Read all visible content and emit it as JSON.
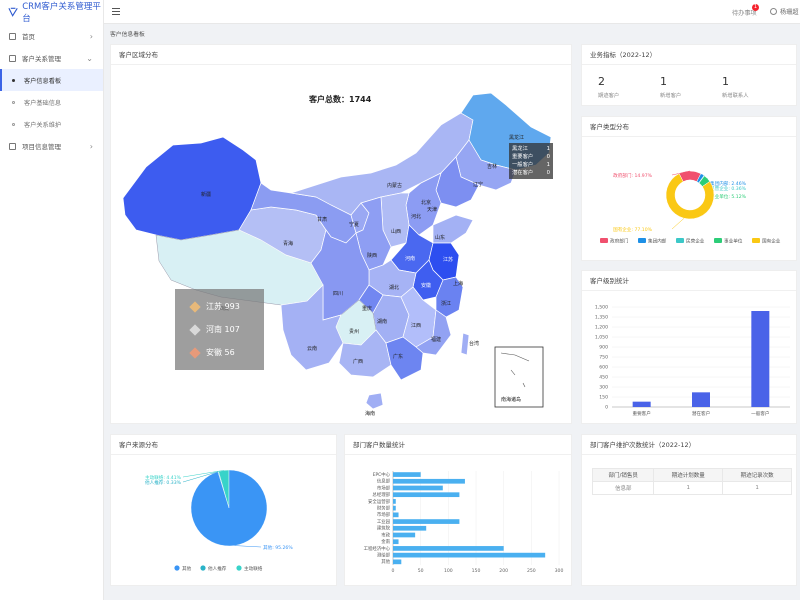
{
  "brand": {
    "title": "CRM客户关系管理平台"
  },
  "sidebar": {
    "items": [
      {
        "label": "首页",
        "arrow": "›"
      },
      {
        "label": "客户关系管理",
        "arrow": "⌄"
      }
    ],
    "sub_items": [
      {
        "label": "客户信息看板"
      },
      {
        "label": "客户基础信息"
      },
      {
        "label": "客户关系维护"
      }
    ],
    "project": {
      "label": "项目信息管理",
      "arrow": "›"
    }
  },
  "header": {
    "todo_label": "待办事项",
    "badge_count": "1",
    "username": "杨珊超"
  },
  "breadcrumb": "客户信息看板",
  "map_card": {
    "title": "客户区域分布",
    "total": "客户总数：1744",
    "tooltip": {
      "rows": [
        {
          "label": "黑龙江",
          "value": "1"
        },
        {
          "label": "重要客户",
          "value": "0"
        },
        {
          "label": "一般客户",
          "value": "1"
        },
        {
          "label": "潜在客户",
          "value": "0"
        }
      ]
    },
    "legend": [
      {
        "label": "江苏 993",
        "color": "#e8b97a"
      },
      {
        "label": "河南 107",
        "color": "#d9d9d9"
      },
      {
        "label": "安徽 56",
        "color": "#e89a7a"
      }
    ],
    "provinces": {
      "xinjiang": "新疆",
      "xizang": "西藏",
      "qinghai": "青海",
      "gansu": "甘肃",
      "neimenggu": "内蒙古",
      "heilongjiang": "黑龙江",
      "jilin": "吉林",
      "liaoning": "辽宁",
      "beijing": "北京",
      "tianjin": "天津",
      "hebei": "河北",
      "shanxi": "山西",
      "shandong": "山东",
      "henan": "河南",
      "jiangsu": "江苏",
      "anhui": "安徽",
      "shanghai": "上海",
      "zhejiang": "浙江",
      "hubei": "湖北",
      "hunan": "湖南",
      "jiangxi": "江西",
      "fujian": "福建",
      "guangdong": "广东",
      "guangxi": "广西",
      "guizhou": "贵州",
      "yunnan": "云南",
      "sichuan": "四川",
      "chongqing": "重庆",
      "shaanxi": "陕西",
      "ningxia": "宁夏",
      "taiwan": "台湾",
      "hainan": "海南",
      "south_sea": "南海诸岛"
    }
  },
  "stats_card": {
    "title": "业务指标（2022-12）",
    "items": [
      {
        "value": "2",
        "label": "期迹客户"
      },
      {
        "value": "1",
        "label": "新增客户"
      },
      {
        "value": "1",
        "label": "新增联系人"
      }
    ]
  },
  "type_card": {
    "title": "客户类型分布",
    "chart_data": {
      "type": "pie",
      "labels": [
        "政府部门",
        "集团内部",
        "民营企业",
        "事业单位",
        "国有企业"
      ],
      "values": [
        14.97,
        2.46,
        0.36,
        5.12,
        77.1
      ],
      "colors": [
        "#f0506e",
        "#1e90e6",
        "#3cc8c8",
        "#2dcd78",
        "#fac814"
      ],
      "data_labels": [
        "政府部门: 14.97%",
        "集团内部: 2.46%",
        "民营企业: 0.36%",
        "事业单位: 5.12%",
        "国有企业: 77.10%"
      ]
    }
  },
  "level_card": {
    "title": "客户级别统计",
    "chart_data": {
      "type": "bar",
      "categories": [
        "重要客户",
        "潜在客户",
        "一般客户"
      ],
      "values": [
        80,
        220,
        1440
      ],
      "ylim": [
        0,
        1500
      ],
      "yticks": [
        "0",
        "150",
        "300",
        "450",
        "600",
        "750",
        "900",
        "1,050",
        "1,200",
        "1,350",
        "1,500"
      ],
      "color": "#4a63e8"
    }
  },
  "source_card": {
    "title": "客户来源分布",
    "chart_data": {
      "type": "pie",
      "labels": [
        "其他",
        "他人推荐",
        "主动联络"
      ],
      "values": [
        95.26,
        0.33,
        4.41
      ],
      "colors": [
        "#3a95f5",
        "#2ab3c8",
        "#38d3c9"
      ],
      "data_labels": [
        "其他: 95.26%",
        "他人推荐: 0.33%",
        "主动联络: 4.41%"
      ]
    }
  },
  "dept_card": {
    "title": "部门客户数量统计",
    "chart_data": {
      "type": "bar",
      "orientation": "horizontal",
      "categories": [
        "EPC中心",
        "信息部",
        "市场部",
        "总经理部",
        "安全运营部",
        "财务部",
        "市场部",
        "工业园",
        "建筑院",
        "市政",
        "金南",
        "工程经济中心",
        "测绘部",
        "其他"
      ],
      "values": [
        50,
        130,
        90,
        120,
        5,
        5,
        10,
        120,
        60,
        40,
        10,
        200,
        275,
        15
      ],
      "xlim": [
        0,
        300
      ],
      "xticks": [
        "0",
        "50",
        "100",
        "150",
        "200",
        "250",
        "300"
      ],
      "color": "#4ab0f0"
    }
  },
  "maint_card": {
    "title": "部门客户维护次数统计（2022-12）",
    "columns": [
      "部门/销售员",
      "期迹计划数量",
      "期迹记录次数"
    ],
    "rows": [
      [
        "信息部",
        "1",
        "1"
      ]
    ]
  }
}
